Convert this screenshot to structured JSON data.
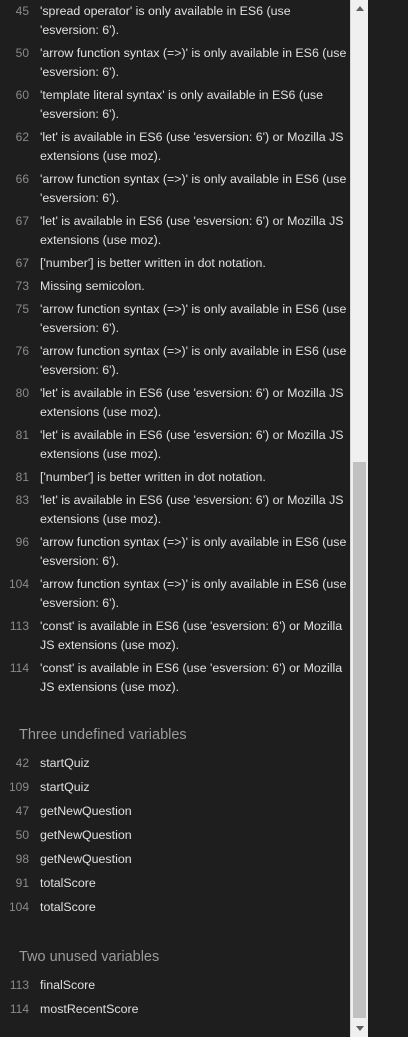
{
  "warnings": [
    {
      "line": "45",
      "text": "'spread operator' is only available in ES6 (use 'esversion: 6')."
    },
    {
      "line": "50",
      "text": "'arrow function syntax (=>)' is only available in ES6 (use 'esversion: 6')."
    },
    {
      "line": "60",
      "text": "'template literal syntax' is only available in ES6 (use 'esversion: 6')."
    },
    {
      "line": "62",
      "text": "'let' is available in ES6 (use 'esversion: 6') or Mozilla JS extensions (use moz)."
    },
    {
      "line": "66",
      "text": "'arrow function syntax (=>)' is only available in ES6 (use 'esversion: 6')."
    },
    {
      "line": "67",
      "text": "'let' is available in ES6 (use 'esversion: 6') or Mozilla JS extensions (use moz)."
    },
    {
      "line": "67",
      "text": "['number'] is better written in dot notation."
    },
    {
      "line": "73",
      "text": "Missing semicolon."
    },
    {
      "line": "75",
      "text": "'arrow function syntax (=>)' is only available in ES6 (use 'esversion: 6')."
    },
    {
      "line": "76",
      "text": "'arrow function syntax (=>)' is only available in ES6 (use 'esversion: 6')."
    },
    {
      "line": "80",
      "text": "'let' is available in ES6 (use 'esversion: 6') or Mozilla JS extensions (use moz)."
    },
    {
      "line": "81",
      "text": "'let' is available in ES6 (use 'esversion: 6') or Mozilla JS extensions (use moz)."
    },
    {
      "line": "81",
      "text": "['number'] is better written in dot notation."
    },
    {
      "line": "83",
      "text": "'let' is available in ES6 (use 'esversion: 6') or Mozilla JS extensions (use moz)."
    },
    {
      "line": "96",
      "text": "'arrow function syntax (=>)' is only available in ES6 (use 'esversion: 6')."
    },
    {
      "line": "104",
      "text": "'arrow function syntax (=>)' is only available in ES6 (use 'esversion: 6')."
    },
    {
      "line": "113",
      "text": "'const' is available in ES6 (use 'esversion: 6') or Mozilla JS extensions (use moz)."
    },
    {
      "line": "114",
      "text": "'const' is available in ES6 (use 'esversion: 6') or Mozilla JS extensions (use moz)."
    }
  ],
  "undefined_section": {
    "title": "Three undefined variables",
    "items": [
      {
        "line": "42",
        "name": "startQuiz"
      },
      {
        "line": "109",
        "name": "startQuiz"
      },
      {
        "line": "47",
        "name": "getNewQuestion"
      },
      {
        "line": "50",
        "name": "getNewQuestion"
      },
      {
        "line": "98",
        "name": "getNewQuestion"
      },
      {
        "line": "91",
        "name": "totalScore"
      },
      {
        "line": "104",
        "name": "totalScore"
      }
    ]
  },
  "unused_section": {
    "title": "Two unused variables",
    "items": [
      {
        "line": "113",
        "name": "finalScore"
      },
      {
        "line": "114",
        "name": "mostRecentScore"
      }
    ]
  },
  "scrollbar": {
    "position_fraction": 0.45,
    "up_icon": "triangle-up",
    "down_icon": "triangle-down"
  },
  "colors": {
    "background": "#1e1e1e",
    "text": "#e0e0e0",
    "line_number": "#8a8a8a",
    "section_title": "#9a9a9a"
  }
}
